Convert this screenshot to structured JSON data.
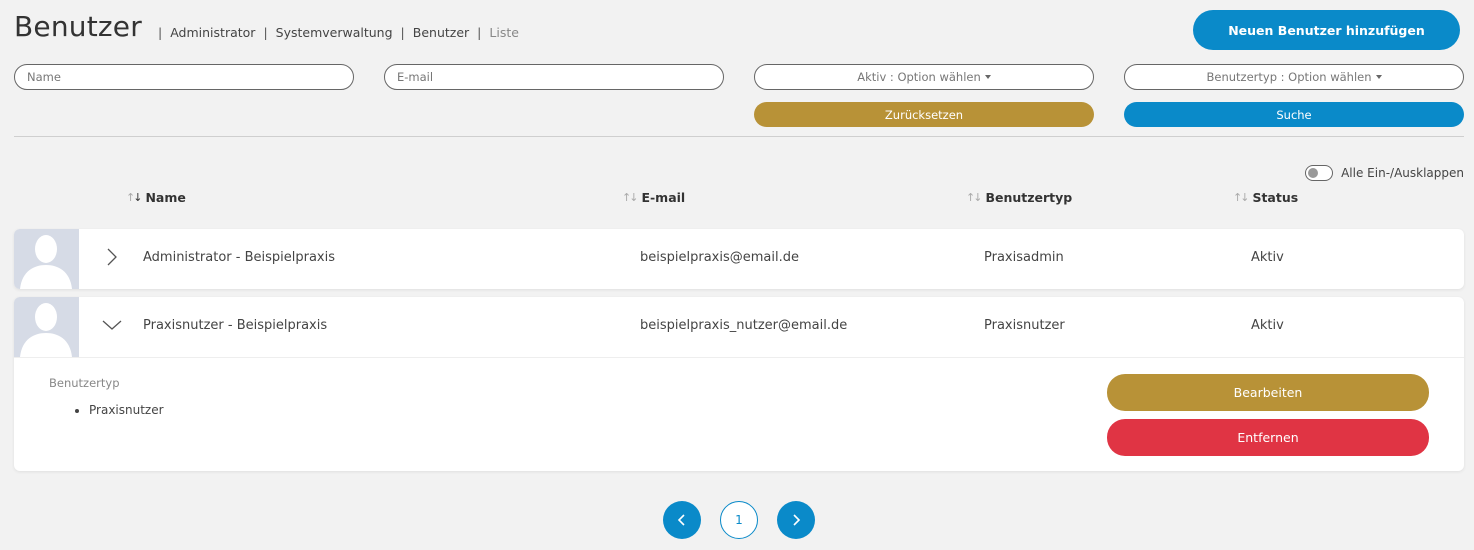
{
  "header": {
    "title": "Benutzer",
    "breadcrumb": [
      "Administrator",
      "Systemverwaltung",
      "Benutzer",
      "Liste"
    ],
    "add_button_label": "Neuen Benutzer hinzufügen"
  },
  "filters": {
    "name_placeholder": "Name",
    "email_placeholder": "E-mail",
    "active_select": "Aktiv : Option wählen",
    "type_select": "Benutzertyp : Option wählen",
    "reset_label": "Zurücksetzen",
    "search_label": "Suche"
  },
  "toggle_label": "Alle Ein-/Ausklappen",
  "columns": [
    "Name",
    "E-mail",
    "Benutzertyp",
    "Status"
  ],
  "rows": [
    {
      "name": "Administrator - Beispielpraxis",
      "email": "beispielpraxis@email.de",
      "type": "Praxisadmin",
      "status": "Aktiv",
      "expanded": false
    },
    {
      "name": "Praxisnutzer - Beispielpraxis",
      "email": "beispielpraxis_nutzer@email.de",
      "type": "Praxisnutzer",
      "status": "Aktiv",
      "expanded": true
    }
  ],
  "details": {
    "label": "Benutzertyp",
    "items": [
      "Praxisnutzer"
    ],
    "edit_label": "Bearbeiten",
    "delete_label": "Entfernen"
  },
  "pagination": {
    "current_page": "1"
  },
  "colors": {
    "primary": "#0a8ac9",
    "gold": "#b89237",
    "danger": "#e03444"
  },
  "icons": [
    "sort-icon",
    "chevron-right-icon",
    "chevron-down-icon",
    "user-silhouette-icon",
    "chevron-left-icon"
  ]
}
